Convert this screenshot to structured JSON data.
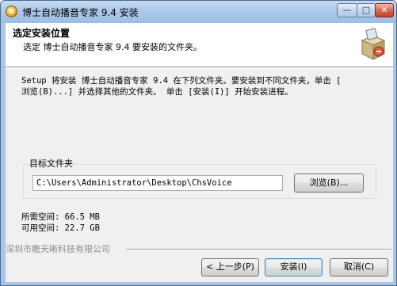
{
  "window": {
    "title": "博士自动播音专家 9.4 安装",
    "app_icon_glyph": "ʊ",
    "controls": {
      "minimize": "—",
      "maximize": "□",
      "close": "✕"
    }
  },
  "header": {
    "title": "选定安装位置",
    "subtitle": "选定 博士自动播音专家 9.4 要安装的文件夹。",
    "icon": "installer-box-icon"
  },
  "description": "Setup 将安装 博士自动播音专家 9.4 在下列文件夹。要安装到不同文件夹，单击 [\n浏览(B)...] 并选择其他的文件夹。 单击 [安装(I)] 开始安装进程。",
  "destination": {
    "group_label": "目标文件夹",
    "path": "C:\\Users\\Administrator\\Desktop\\ChsVoice",
    "browse_label": "浏览(B)..."
  },
  "space": {
    "required": "所需空间: 66.5 MB",
    "available": "可用空间: 22.7 GB"
  },
  "brand": "深圳市瞻天晰科技有限公司",
  "buttons": {
    "back": "< 上一步(P)",
    "install": "安装(I)",
    "cancel": "取消(C)"
  }
}
